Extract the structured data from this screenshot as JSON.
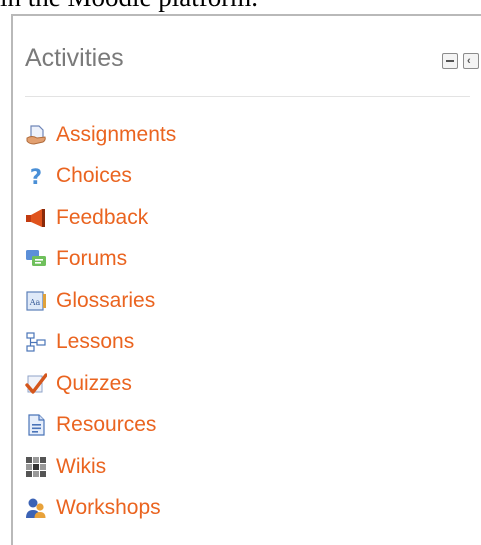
{
  "page": {
    "top_fragment": "in the Moodle platform."
  },
  "block": {
    "title": "Activities",
    "controls": [
      {
        "name": "hide-block",
        "icon": "minus-box-icon"
      },
      {
        "name": "dock-block",
        "icon": "chevron-left-box-icon"
      }
    ],
    "items": [
      {
        "label": "Assignments",
        "icon": "assignment-icon"
      },
      {
        "label": "Choices",
        "icon": "question-mark-icon"
      },
      {
        "label": "Feedback",
        "icon": "megaphone-icon"
      },
      {
        "label": "Forums",
        "icon": "forum-icon"
      },
      {
        "label": "Glossaries",
        "icon": "glossary-icon"
      },
      {
        "label": "Lessons",
        "icon": "lesson-icon"
      },
      {
        "label": "Quizzes",
        "icon": "checkmark-icon"
      },
      {
        "label": "Resources",
        "icon": "document-icon"
      },
      {
        "label": "Wikis",
        "icon": "wiki-icon"
      },
      {
        "label": "Workshops",
        "icon": "workshop-people-icon"
      }
    ]
  },
  "colors": {
    "link": "#ea6420",
    "title": "#7a7a7a",
    "border": "#b9b9b9"
  }
}
